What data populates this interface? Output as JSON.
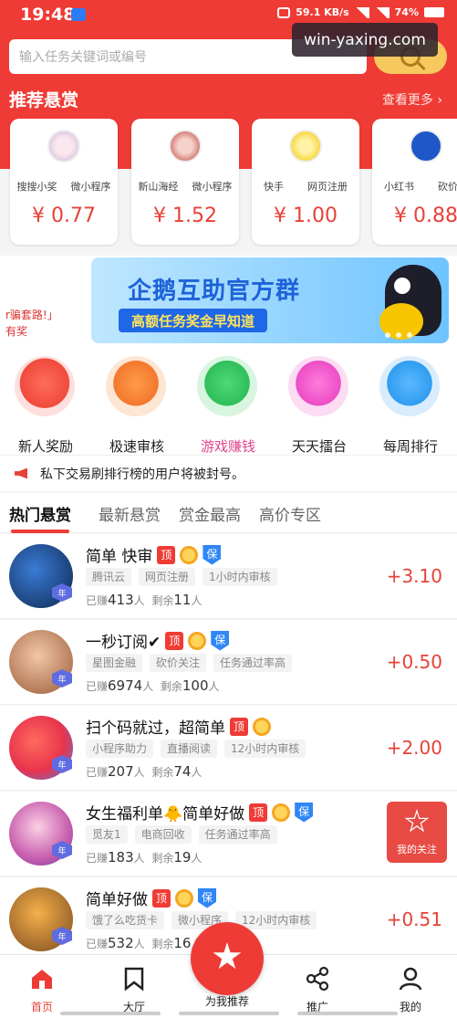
{
  "status_bar": {
    "time": "19:48",
    "net_speed": "59.1 KB/s",
    "battery": "74%"
  },
  "watermark": "win-yaxing.com",
  "search": {
    "placeholder": "输入任务关键词或编号"
  },
  "recommend": {
    "title": "推荐悬赏",
    "more": "查看更多 ›",
    "cards": [
      {
        "tag1": "搜搜小奖",
        "tag2": "微小程序",
        "price": "¥ 0.77"
      },
      {
        "tag1": "新山海经",
        "tag2": "微小程序",
        "price": "¥ 1.52"
      },
      {
        "tag1": "快手",
        "tag2": "网页注册",
        "price": "¥ 1.00"
      },
      {
        "tag1": "小红书",
        "tag2": "砍价关",
        "price": "¥ 0.88"
      }
    ]
  },
  "banner": {
    "left_line1": "r骗套路!」",
    "left_line2": "有奖",
    "title": "企鹅互助官方群",
    "subtitle": "高额任务奖金早知道"
  },
  "categories": [
    {
      "label": "新人奖励",
      "color": "#f04a3d",
      "icon": "gift-icon"
    },
    {
      "label": "极速审核",
      "color": "#f3782e",
      "icon": "document-icon"
    },
    {
      "label": "游戏赚钱",
      "color": "#2fbf5a",
      "icon": "gamepad-icon"
    },
    {
      "label": "天天擂台",
      "color": "#ec4ec6",
      "icon": "flag-icon"
    },
    {
      "label": "每周排行",
      "color": "#2f9df0",
      "icon": "bar-chart-icon"
    }
  ],
  "notice": "私下交易刷排行榜的用户将被封号。",
  "tabs": [
    "热门悬赏",
    "最新悬赏",
    "赏金最高",
    "高价专区"
  ],
  "tasks": [
    {
      "title": "简单 快审",
      "top": "顶",
      "bao": "保",
      "tags": [
        "腾讯云",
        "网页注册",
        "1小时内审核"
      ],
      "earned_label": "已赚",
      "earned": "413",
      "earned_unit": "人",
      "remain_label": "剩余",
      "remain": "11",
      "remain_unit": "人",
      "amount": "+3.10",
      "year": "年",
      "has_bao": true
    },
    {
      "title": "一秒订阅✔",
      "top": "顶",
      "bao": "保",
      "tags": [
        "星图金融",
        "砍价关注",
        "任务通过率高"
      ],
      "earned_label": "已赚",
      "earned": "6974",
      "earned_unit": "人",
      "remain_label": "剩余",
      "remain": "100",
      "remain_unit": "人",
      "amount": "+0.50",
      "year": "年",
      "has_bao": true
    },
    {
      "title": "扫个码就过，超简单",
      "top": "顶",
      "bao": "",
      "tags": [
        "小程序助力",
        "直播阅读",
        "12小时内审核"
      ],
      "earned_label": "已赚",
      "earned": "207",
      "earned_unit": "人",
      "remain_label": "剩余",
      "remain": "74",
      "remain_unit": "人",
      "amount": "+2.00",
      "year": "年",
      "has_bao": false
    },
    {
      "title": "女生福利单🐥简单好做",
      "top": "顶",
      "bao": "保",
      "tags": [
        "觅友1",
        "电商回收",
        "任务通过率高"
      ],
      "earned_label": "已赚",
      "earned": "183",
      "earned_unit": "人",
      "remain_label": "剩余",
      "remain": "19",
      "remain_unit": "人",
      "amount": "",
      "year": "年",
      "has_bao": true
    },
    {
      "title": "简单好做",
      "top": "顶",
      "bao": "保",
      "tags": [
        "饿了么吃货卡",
        "微小程序",
        "12小时内审核"
      ],
      "earned_label": "已赚",
      "earned": "532",
      "earned_unit": "人",
      "remain_label": "剩余",
      "remain": "16",
      "remain_unit": "人",
      "amount": "+0.51",
      "year": "年",
      "has_bao": true
    }
  ],
  "favorite": {
    "label": "我的关注"
  },
  "bottom_nav": [
    {
      "label": "首页",
      "icon": "home-icon"
    },
    {
      "label": "大厅",
      "icon": "bookmark-icon"
    },
    {
      "label": "为我推荐",
      "icon": "star-icon"
    },
    {
      "label": "推广",
      "icon": "share-icon"
    },
    {
      "label": "我的",
      "icon": "user-icon"
    }
  ],
  "colors": {
    "brand_red": "#ef3b35",
    "price_red": "#e64238",
    "gold": "#f7c85d"
  }
}
